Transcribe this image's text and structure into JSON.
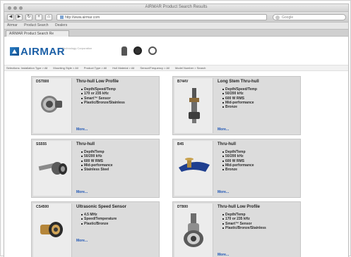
{
  "browser": {
    "window_title": "AIRMAR Product Search Results",
    "url": "http://www.airmar.com",
    "search_placeholder": "Google",
    "bookmarks": [
      "Airmar",
      "Product Search",
      "Dealers"
    ],
    "tab_title": "AIRMAR Product Search Re"
  },
  "site": {
    "logo_text": "AIRMAR",
    "tagline": "Technology Corporation",
    "nav_items": [
      "Selections: Installation Type > All",
      "Mounting Style > All",
      "Product Type > All",
      "Hull Material > All",
      "Sensor/Frequency > All",
      "Model Number > Search"
    ]
  },
  "products": [
    {
      "model": "DST800",
      "title": "Thru-hull Low Profile",
      "features": [
        "Depth/Speed/Temp",
        "170 or 235 kHz",
        "Smart™ Sensor",
        "Plastic/Bronze/Stainless"
      ],
      "more": "More...",
      "image": "low-profile-sensor"
    },
    {
      "model": "B744V",
      "title": "Long Stem Thru-hull",
      "features": [
        "Depth/Speed/Temp",
        "50/200 kHz",
        "600 W RMS",
        "Mid-performance",
        "Bronze"
      ],
      "more": "More...",
      "image": "long-stem-sensor"
    },
    {
      "model": "SS555",
      "title": "Thru-hull",
      "features": [
        "Depth/Temp",
        "50/200 kHz",
        "600 W RMS",
        "Mid-performance",
        "Stainless Steel"
      ],
      "more": "More...",
      "image": "thru-hull-steel"
    },
    {
      "model": "B45",
      "title": "Thru-hull",
      "features": [
        "Depth/Temp",
        "50/200 kHz",
        "600 W RMS",
        "Mid-performance",
        "Bronze"
      ],
      "more": "More...",
      "image": "thru-hull-bronze"
    },
    {
      "model": "CS4500",
      "title": "Ultrasonic Speed Sensor",
      "features": [
        "4.5 MHz",
        "Speed/Temperature",
        "Plastic/Bronze"
      ],
      "more": "More...",
      "image": "speed-sensor"
    },
    {
      "model": "DT800",
      "title": "Thru-hull Low Profile",
      "features": [
        "Depth/Temp",
        "170 or 235 kHz",
        "Smart™ Sensor",
        "Plastic/Bronze/Stainless"
      ],
      "more": "More...",
      "image": "low-profile-sensor-2"
    }
  ]
}
